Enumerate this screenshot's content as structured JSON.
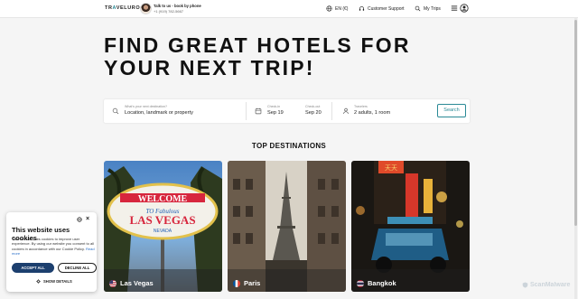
{
  "header": {
    "logo_prefix": "TR",
    "logo_accent": "A",
    "logo_suffix": "VELURO",
    "talk_label": "Talk to us - book by phone",
    "phone": "+1 (919) 782-5667",
    "language": "EN (€)",
    "support": "Customer Support",
    "trips": "My Trips"
  },
  "hero": {
    "title": "FIND GREAT HOTELS FOR YOUR NEXT TRIP!"
  },
  "search": {
    "destination_label": "What's your next destination?",
    "destination_placeholder": "Location, landmark or property",
    "checkin_label": "Check-in",
    "checkin_value": "Sep 19",
    "checkout_label": "Check-out",
    "checkout_value": "Sep 20",
    "travelers_label": "Travelers",
    "travelers_value": "2 adults, 1 room",
    "button": "Search"
  },
  "destinations": {
    "title": "TOP DESTINATIONS",
    "items": [
      {
        "name": "Las Vegas",
        "flag": "us-flag-icon"
      },
      {
        "name": "Paris",
        "flag": "fr-flag-icon"
      },
      {
        "name": "Bangkok",
        "flag": "th-flag-icon"
      }
    ]
  },
  "cookie": {
    "title": "This website uses cookies",
    "text": "This website uses cookies to improve user experience. By using our website you consent to all cookies in accordance with our Cookie Policy.",
    "read_more": "Read more",
    "accept": "ACCEPT ALL",
    "decline": "DECLINE ALL",
    "details": "SHOW DETAILS"
  },
  "watermark": "ScanMalware",
  "colors": {
    "accent": "#2a8a96",
    "accept_button": "#1c3f6e",
    "background": "#f5f5f5"
  }
}
